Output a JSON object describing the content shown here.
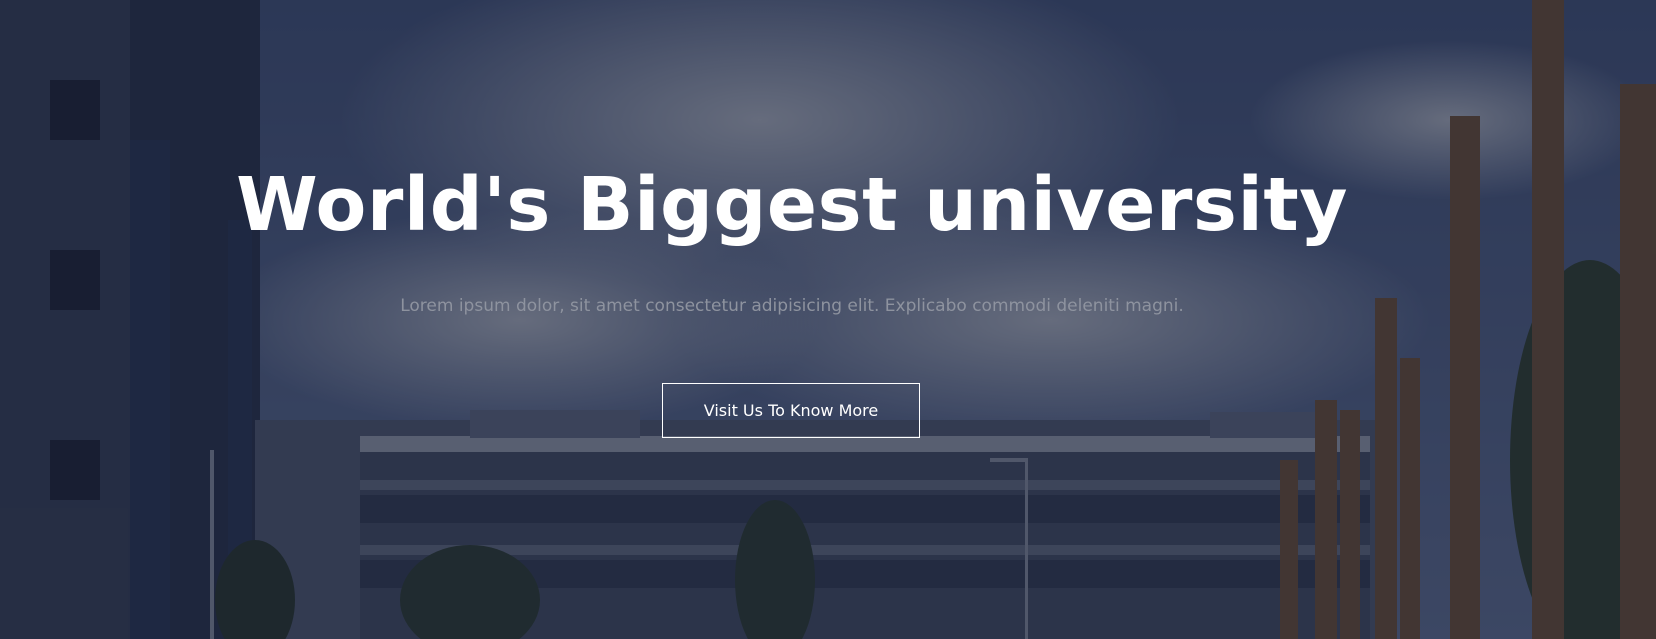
{
  "hero": {
    "title": "World's Biggest university",
    "subtitle": "Lorem ipsum dolor, sit amet consectetur adipisicing elit. Explicabo commodi deleniti magni.",
    "cta_label": "Visit Us To Know More"
  },
  "colors": {
    "overlay": "#141a2d",
    "title": "#ffffff",
    "subtitle": "#8e939f",
    "button_border": "#ffffff"
  }
}
